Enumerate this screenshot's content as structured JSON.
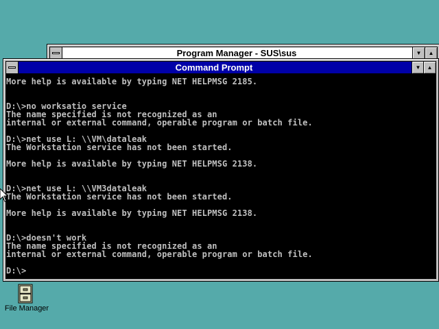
{
  "program_manager": {
    "title": "Program Manager - SUS\\sus",
    "min_glyph": "▼",
    "max_glyph": "▲"
  },
  "command_prompt": {
    "title": "Command Prompt",
    "min_glyph": "▼",
    "max_glyph": "▲",
    "lines": [
      "More help is available by typing NET HELPMSG 2185.",
      "",
      "",
      "D:\\>no worksatio service",
      "The name specified is not recognized as an",
      "internal or external command, operable program or batch file.",
      "",
      "D:\\>net use L: \\\\VM\\dataleak",
      "The Workstation service has not been started.",
      "",
      "More help is available by typing NET HELPMSG 2138.",
      "",
      "",
      "D:\\>net use L: \\\\VM3dataleak",
      "The Workstation service has not been started.",
      "",
      "More help is available by typing NET HELPMSG 2138.",
      "",
      "",
      "D:\\>doesn't work",
      "The name specified is not recognized as an",
      "internal or external command, operable program or batch file.",
      "",
      "D:\\>"
    ]
  },
  "desktop": {
    "file_manager_label": "File Manager"
  },
  "colors": {
    "desktop": "#55aaaa",
    "active_title": "#0000a8",
    "console_bg": "#000000",
    "console_text": "#c0c0c0"
  }
}
